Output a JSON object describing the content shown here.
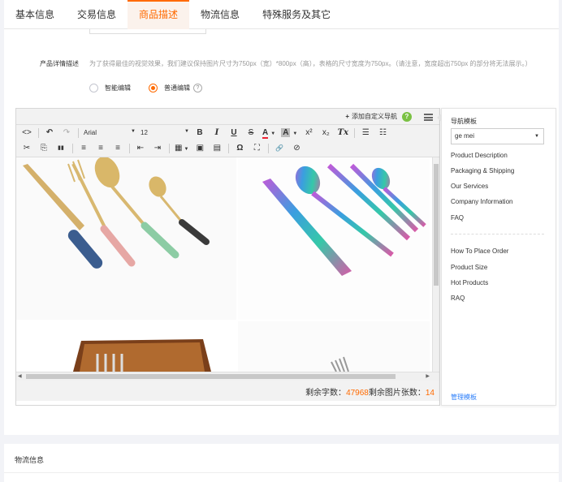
{
  "tabs": [
    "基本信息",
    "交易信息",
    "商品描述",
    "物流信息",
    "特殊服务及其它"
  ],
  "desc": {
    "label": "产品详情描述",
    "tip": "为了获得最佳的视觉效果，我们建议保持图片尺寸为750px（宽）*800px（高），表格的尺寸宽度为750px。（请注意，宽度超出750px 的部分将无法展示。）",
    "mode_smart": "智能编辑",
    "mode_normal": "普通编辑",
    "help_glyph": "?"
  },
  "editor": {
    "add_nav": "添加自定义导航",
    "add_nav_plus": "+",
    "help_glyph": "?",
    "toolbar": {
      "source": "<>",
      "undo": "↶",
      "redo": "↷",
      "font": "Arial",
      "size": "12",
      "bold": "B",
      "italic": "I",
      "underline": "U",
      "strike": "S",
      "color": "A",
      "bgcolor": "A",
      "sup": "x²",
      "sub": "x₂",
      "clear": "Tx",
      "ul": "☰",
      "ol": "☷",
      "cut": "✂",
      "copy": "⎘",
      "find": "▮▮",
      "align_left": "≡",
      "align_center": "≡",
      "align_right": "≡",
      "indent_less": "⇤",
      "indent_more": "⇥",
      "table": "▦",
      "image": "▣",
      "media": "▤",
      "omega": "Ω",
      "fullscreen": "⛶",
      "link": "🔗",
      "unlink": "⊘",
      "caret": "▼"
    },
    "status_words_label": "剩余字数：",
    "status_words_value": "47968",
    "status_images_label": "剩余图片张数：",
    "status_images_value": "14"
  },
  "nav_panel": {
    "title": "导航模板",
    "selected": "ge mei",
    "group1": [
      "Product Description",
      "Packaging & Shipping",
      "Our Services",
      "Company Information",
      "FAQ"
    ],
    "group2": [
      "How To Place Order",
      "Product Size",
      "Hot Products",
      "RAQ"
    ],
    "manage": "管理模板"
  },
  "logistics_title": "物流信息",
  "colors": {
    "accent": "#ff6a00",
    "link": "#2d7ff9",
    "help_green": "#7ac143"
  }
}
